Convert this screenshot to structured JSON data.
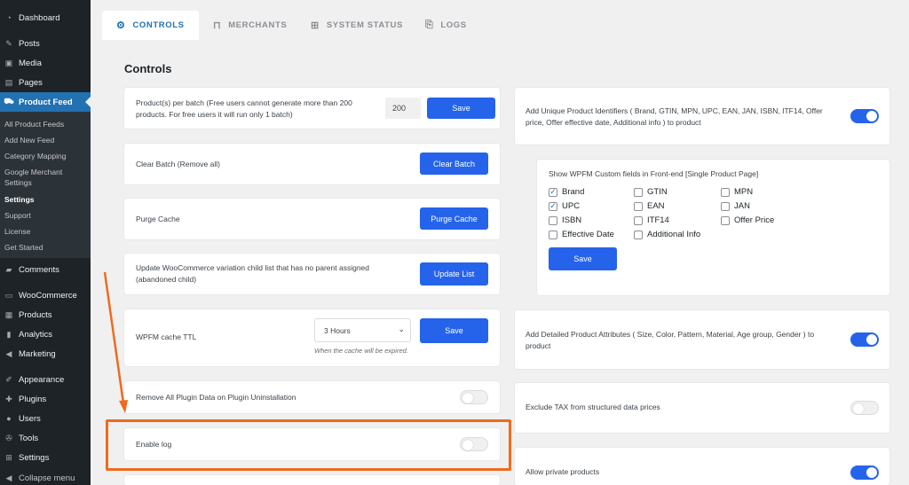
{
  "sidebar": {
    "items": [
      {
        "label": "Dashboard",
        "icon": "dashboard-icon",
        "glyph": "◔"
      },
      {
        "label": "Posts",
        "icon": "pin-icon",
        "glyph": "✎"
      },
      {
        "label": "Media",
        "icon": "media-icon",
        "glyph": "▣"
      },
      {
        "label": "Pages",
        "icon": "pages-icon",
        "glyph": "▤"
      },
      {
        "label": "Product Feed",
        "icon": "cart-icon",
        "glyph": "⛟"
      },
      {
        "label": "Comments",
        "icon": "comment-icon",
        "glyph": "▰"
      },
      {
        "label": "WooCommerce",
        "icon": "woo-icon",
        "glyph": "▭"
      },
      {
        "label": "Products",
        "icon": "box-icon",
        "glyph": "▦"
      },
      {
        "label": "Analytics",
        "icon": "chart-icon",
        "glyph": "▮"
      },
      {
        "label": "Marketing",
        "icon": "megaphone-icon",
        "glyph": "◀"
      },
      {
        "label": "Appearance",
        "icon": "brush-icon",
        "glyph": "✐"
      },
      {
        "label": "Plugins",
        "icon": "plug-icon",
        "glyph": "✚"
      },
      {
        "label": "Users",
        "icon": "user-icon",
        "glyph": "●"
      },
      {
        "label": "Tools",
        "icon": "wrench-icon",
        "glyph": "✇"
      },
      {
        "label": "Settings",
        "icon": "settings-icon",
        "glyph": "⊞"
      },
      {
        "label": "Collapse menu",
        "icon": "collapse-icon",
        "glyph": "◀"
      }
    ],
    "submenu": [
      "All Product Feeds",
      "Add New Feed",
      "Category Mapping",
      "Google Merchant",
      "Settings",
      "Settings",
      "Support",
      "License",
      "Get Started"
    ]
  },
  "tabs": [
    {
      "label": "CONTROLS",
      "icon": "gears-icon",
      "glyph": "⚙"
    },
    {
      "label": "MERCHANTS",
      "icon": "basket-icon",
      "glyph": "⊓"
    },
    {
      "label": "SYSTEM STATUS",
      "icon": "grid-icon",
      "glyph": "⊞"
    },
    {
      "label": "LOGS",
      "icon": "file-icon",
      "glyph": "⎘"
    }
  ],
  "heading": "Controls",
  "left": {
    "batch": {
      "text": "Product(s) per batch (Free users cannot generate more than 200 products. For free users it will run only 1 batch)",
      "value": "200",
      "button": "Save"
    },
    "clear_batch": {
      "text": "Clear Batch (Remove all)",
      "button": "Clear Batch"
    },
    "purge": {
      "text": "Purge Cache",
      "button": "Purge Cache"
    },
    "update_list": {
      "text": "Update WooCommerce variation child list that has no parent assigned (abandoned child)",
      "button": "Update List"
    },
    "ttl": {
      "text": "WPFM cache TTL",
      "selected": "3 Hours",
      "hint": "When the cache will be expired.",
      "button": "Save"
    },
    "remove_data": {
      "text": "Remove All Plugin Data on Plugin Uninstallation",
      "enabled": false
    },
    "enable_log": {
      "text": "Enable log",
      "enabled": false
    }
  },
  "right": {
    "unique_ids": {
      "text": "Add Unique Product Identifiers ( Brand, GTIN, MPN, UPC, EAN, JAN, ISBN, ITF14, Offer price, Offer effective date, Additional info ) to product",
      "enabled": true
    },
    "custom_fields": {
      "title": "Show WPFM Custom fields in Front-end [Single Product Page]",
      "options": [
        {
          "label": "Brand",
          "checked": true
        },
        {
          "label": "GTIN",
          "checked": false
        },
        {
          "label": "MPN",
          "checked": false
        },
        {
          "label": "UPC",
          "checked": true
        },
        {
          "label": "EAN",
          "checked": false
        },
        {
          "label": "JAN",
          "checked": false
        },
        {
          "label": "ISBN",
          "checked": false
        },
        {
          "label": "ITF14",
          "checked": false
        },
        {
          "label": "Offer Price",
          "checked": false
        },
        {
          "label": "Effective Date",
          "checked": false
        },
        {
          "label": "Additional Info",
          "checked": false
        }
      ],
      "button": "Save"
    },
    "detailed_attrs": {
      "text": "Add Detailed Product Attributes ( Size, Color, Pattern, Material, Age group, Gender ) to product",
      "enabled": true
    },
    "exclude_tax": {
      "text": "Exclude TAX from structured data prices",
      "enabled": false
    },
    "private_products": {
      "text": "Allow private products",
      "enabled": true
    }
  },
  "colors": {
    "accent": "#2563eb",
    "highlight": "#f06a1c",
    "sidebar": "#1d2327",
    "active_menu": "#2271b1"
  }
}
